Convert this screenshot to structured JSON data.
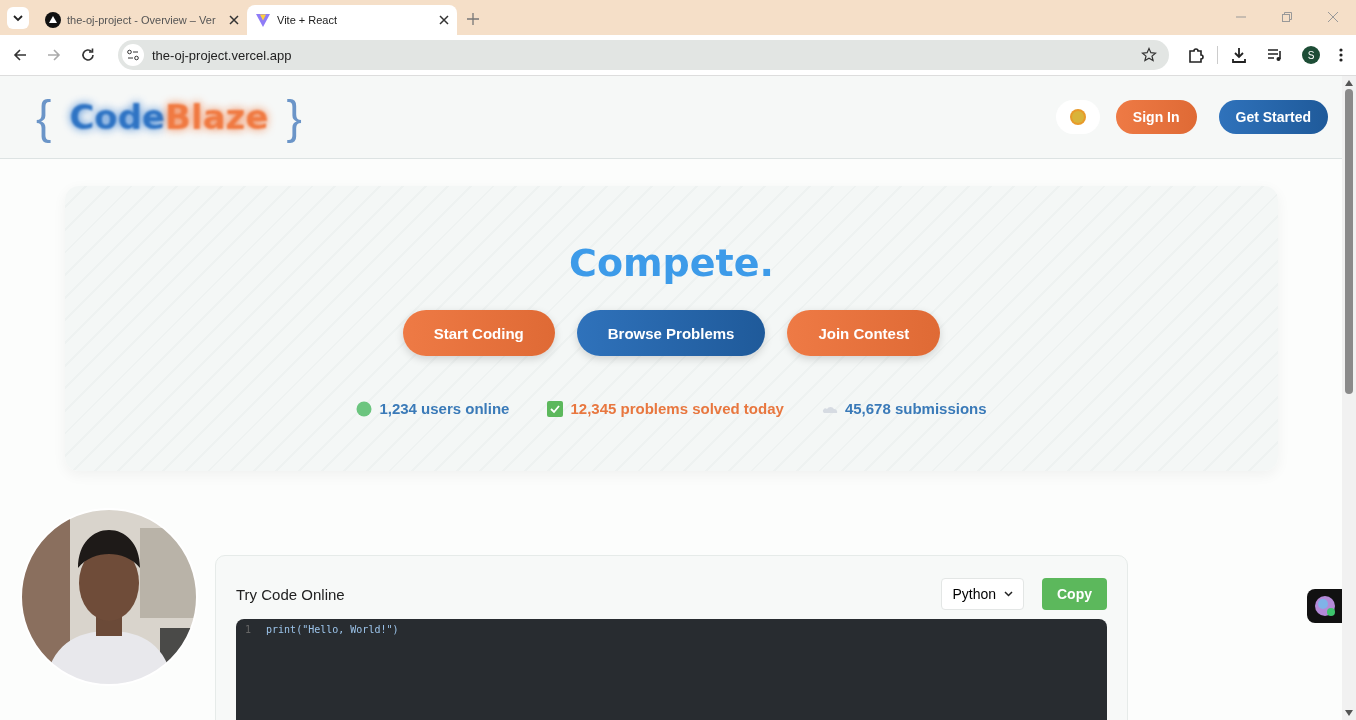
{
  "browser": {
    "tabs": [
      {
        "title": "the-oj-project - Overview – Ver",
        "selected": false,
        "kind": "vercel"
      },
      {
        "title": "Vite + React",
        "selected": true,
        "kind": "vite"
      }
    ],
    "address": "the-oj-project.vercel.app",
    "profile_initial": "S"
  },
  "header": {
    "logo": {
      "open_brace": "{",
      "part_1": "Code",
      "part_2": "Blaze",
      "close_brace": "}"
    },
    "buttons": [
      {
        "label": "Sign In",
        "kind": "orange"
      },
      {
        "label": "Get Started",
        "kind": "blue"
      }
    ]
  },
  "hero": {
    "headline": "Compete.",
    "buttons": [
      {
        "label": "Start Coding",
        "kind": "orange"
      },
      {
        "label": "Browse Problems",
        "kind": "blue"
      },
      {
        "label": "Join Contest",
        "kind": "orange"
      }
    ],
    "stats": [
      {
        "kind": "dot",
        "text": "1,234 users online",
        "color": "#3a7ab8"
      },
      {
        "kind": "check",
        "text": "12,345 problems solved today",
        "color": "#e8773f"
      },
      {
        "kind": "cloud",
        "text": "45,678 submissions",
        "color": "#3a7ab8"
      }
    ]
  },
  "editor": {
    "title": "Try Code Online",
    "language": "Python",
    "copy_button": "Copy",
    "lines": [
      {
        "number": "1",
        "code": "print(\"Hello, World!\")"
      }
    ]
  }
}
